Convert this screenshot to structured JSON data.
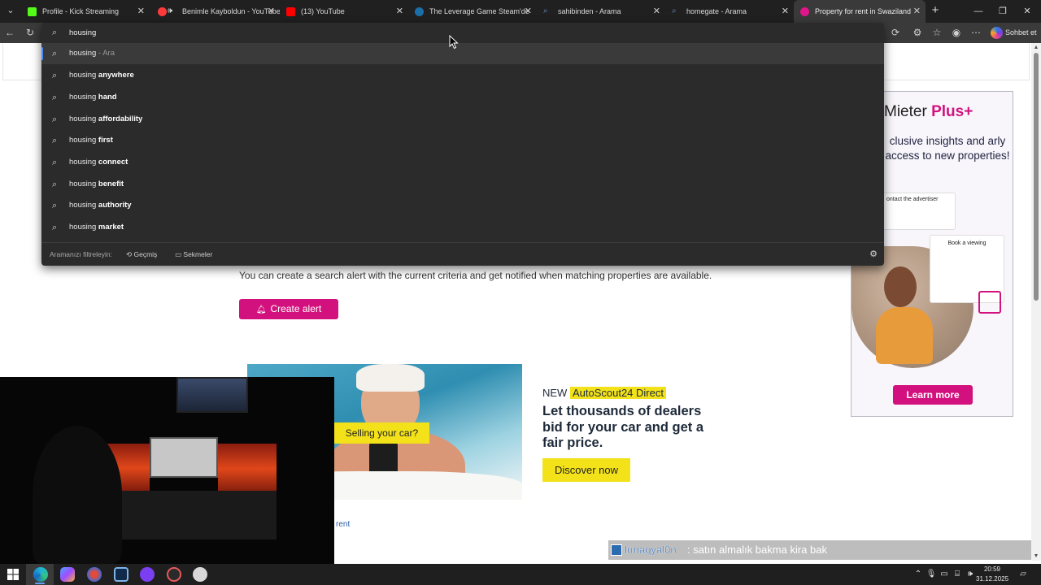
{
  "tabs": [
    {
      "title": "Profile - Kick Streaming",
      "favicon_color": "#53fc18"
    },
    {
      "title": "Benimle Kayboldun - YouTube",
      "favicon_color": "#ff3a3a"
    },
    {
      "title": "(13) YouTube",
      "favicon_color": "#ff0000"
    },
    {
      "title": "The Leverage Game Steam'de",
      "favicon_color": "#1b6ea8"
    },
    {
      "title": "sahibinden - Arama",
      "favicon_color": "#6c8ebf"
    },
    {
      "title": "homegate - Arama",
      "favicon_color": "#6c8ebf"
    },
    {
      "title": "Property for rent in Swaziland",
      "favicon_color": "#e0168a"
    }
  ],
  "toolbar": {
    "copilot_label": "Sohbet et"
  },
  "search": {
    "query": "housing",
    "suggestions": [
      {
        "base": "housing",
        "bold": "",
        "suffix": " - Ara"
      },
      {
        "base": "housing ",
        "bold": "anywhere",
        "suffix": ""
      },
      {
        "base": "housing ",
        "bold": "hand",
        "suffix": ""
      },
      {
        "base": "housing ",
        "bold": "affordability",
        "suffix": ""
      },
      {
        "base": "housing ",
        "bold": "first",
        "suffix": ""
      },
      {
        "base": "housing ",
        "bold": "connect",
        "suffix": ""
      },
      {
        "base": "housing ",
        "bold": "benefit",
        "suffix": ""
      },
      {
        "base": "housing ",
        "bold": "authority",
        "suffix": ""
      },
      {
        "base": "housing ",
        "bold": "market",
        "suffix": ""
      }
    ],
    "filter_label": "Aramanızı filtreleyin:",
    "filter_history": "Geçmiş",
    "filter_tabs": "Sekmeler"
  },
  "page": {
    "alert_text": "You can create a search alert with the current criteria and get notified when matching properties are available.",
    "create_alert_label": "Create alert",
    "rent_link": "rent"
  },
  "ad_autoscout": {
    "sell_label": "Selling your car?",
    "new_prefix": "NEW ",
    "brand": "AutoScout24 Direct",
    "headline": "Let thousands of dealers bid for your car and get a fair price.",
    "cta": "Discover now"
  },
  "ad_mieter": {
    "title_main": "Mieter",
    "title_plus": "Plus+",
    "subtitle": "clusive insights and arly access to new properties!",
    "card1_title": "ontact the advertiser",
    "card2_title": "Book a viewing",
    "cta": "Learn more",
    "accent_color": "#d3117e"
  },
  "chat": {
    "user": "lrmaqyal0n",
    "message": ": satın almalık bakma kira bak"
  },
  "clock": {
    "time": "20:59",
    "date": "31.12.2025"
  },
  "accent_color": "#d3117e"
}
